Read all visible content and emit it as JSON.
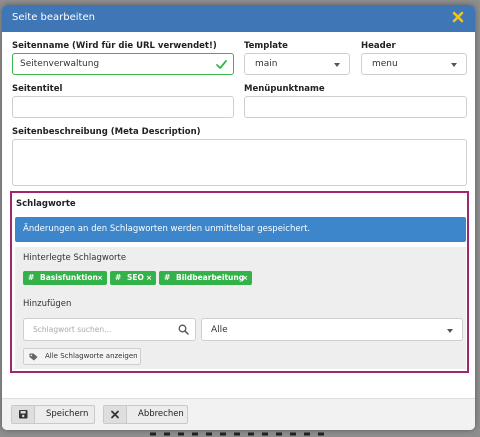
{
  "modal": {
    "title": "Seite bearbeiten",
    "close_icon": "close-icon"
  },
  "form": {
    "page_name_label": "Seitenname (Wird für die URL verwendet!)",
    "page_name_value": "Seitenverwaltung",
    "template_label": "Template",
    "template_value": "main",
    "header_label": "Header",
    "header_value": "menu",
    "page_title_label": "Seitentitel",
    "page_title_value": "",
    "menu_item_label": "Menüpunktname",
    "menu_item_value": "",
    "description_label": "Seitenbeschreibung (Meta Description)",
    "description_value": ""
  },
  "keywords": {
    "title": "Schlagworte",
    "alert": "Änderungen an den Schlagworten werden unmittelbar gespeichert.",
    "stored_label": "Hinterlegte Schlagworte",
    "tags": [
      {
        "hash": "#",
        "name": "Basisfunktion",
        "remove": "×"
      },
      {
        "hash": "#",
        "name": "SEO",
        "remove": "×"
      },
      {
        "hash": "#",
        "name": "Bildbearbeitung",
        "remove": "×"
      }
    ],
    "add_label": "Hinzufügen",
    "search_placeholder": "Schlagwort suchen...",
    "filter_value": "Alle",
    "show_all_label": "Alle Schlagworte anzeigen"
  },
  "footer": {
    "save_label": "Speichern",
    "cancel_label": "Abbrechen"
  },
  "colors": {
    "header": "#3f76b6",
    "alert": "#3d86cc",
    "tag": "#33b24a",
    "section_border": "#a1256f",
    "valid": "#39b54a",
    "close": "#f0c419"
  }
}
